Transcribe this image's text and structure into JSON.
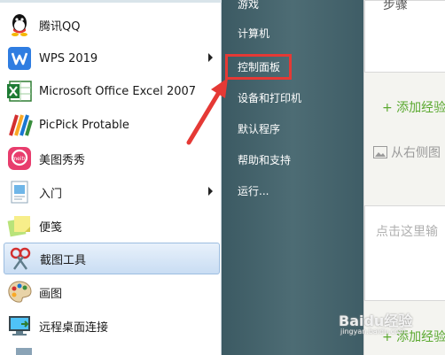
{
  "programs": [
    {
      "label": "腾讯QQ",
      "icon": "qq-icon"
    },
    {
      "label": "WPS 2019",
      "icon": "wps-icon",
      "submenu": true
    },
    {
      "label": "Microsoft Office Excel 2007",
      "icon": "excel-icon"
    },
    {
      "label": "PicPick Protable",
      "icon": "picpick-icon"
    },
    {
      "label": "美图秀秀",
      "icon": "meitu-icon"
    },
    {
      "label": "入门",
      "icon": "getting-started-icon",
      "submenu": true
    },
    {
      "label": "便笺",
      "icon": "sticky-notes-icon"
    },
    {
      "label": "截图工具",
      "icon": "snipping-tool-icon",
      "selected": true
    },
    {
      "label": "画图",
      "icon": "paint-icon"
    },
    {
      "label": "远程桌面连接",
      "icon": "remote-desktop-icon"
    }
  ],
  "right_menu": [
    "游戏",
    "计算机",
    "控制面板",
    "设备和打印机",
    "默认程序",
    "帮助和支持",
    "运行..."
  ],
  "panel": {
    "top_text": "步骤",
    "add_step_1": "+ 添加经验",
    "upload_text": "从右侧图",
    "input_placeholder": "点击这里输",
    "add_step_2": "+ 添加经验",
    "watermark": "Baidu经验",
    "watermark_url": "jingyan.baidu.com"
  },
  "colors": {
    "highlight": "#e53935",
    "green": "#5aa92f",
    "menu_bg": "#4a6870"
  }
}
